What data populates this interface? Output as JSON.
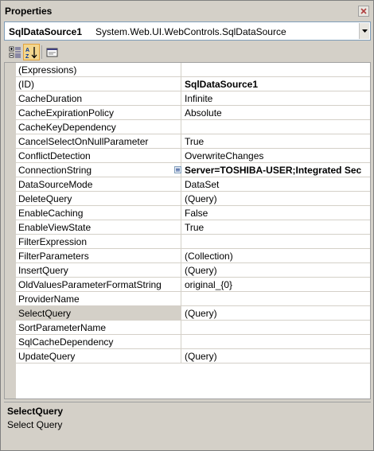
{
  "window": {
    "title": "Properties"
  },
  "selector": {
    "object_name": "SqlDataSource1",
    "object_type": "System.Web.UI.WebControls.SqlDataSource"
  },
  "toolbar": {
    "buttons": [
      {
        "icon": "categorized-icon",
        "active": false
      },
      {
        "icon": "alphabetical-sort-icon",
        "active": true
      },
      {
        "icon": "property-pages-icon",
        "active": false
      }
    ]
  },
  "properties": [
    {
      "name": "(Expressions)",
      "value": ""
    },
    {
      "name": "(ID)",
      "value": "SqlDataSource1",
      "bold": true
    },
    {
      "name": "CacheDuration",
      "value": "Infinite"
    },
    {
      "name": "CacheExpirationPolicy",
      "value": "Absolute"
    },
    {
      "name": "CacheKeyDependency",
      "value": ""
    },
    {
      "name": "CancelSelectOnNullParameter",
      "value": "True"
    },
    {
      "name": "ConflictDetection",
      "value": "OverwriteChanges"
    },
    {
      "name": "ConnectionString",
      "value": "Server=TOSHIBA-USER;Integrated Sec",
      "bold": true,
      "expandable": true
    },
    {
      "name": "DataSourceMode",
      "value": "DataSet"
    },
    {
      "name": "DeleteQuery",
      "value": "(Query)"
    },
    {
      "name": "EnableCaching",
      "value": "False"
    },
    {
      "name": "EnableViewState",
      "value": "True"
    },
    {
      "name": "FilterExpression",
      "value": ""
    },
    {
      "name": "FilterParameters",
      "value": "(Collection)"
    },
    {
      "name": "InsertQuery",
      "value": "(Query)"
    },
    {
      "name": "OldValuesParameterFormatString",
      "value": "original_{0}"
    },
    {
      "name": "ProviderName",
      "value": ""
    },
    {
      "name": "SelectQuery",
      "value": "(Query)",
      "selected": true
    },
    {
      "name": "SortParameterName",
      "value": ""
    },
    {
      "name": "SqlCacheDependency",
      "value": ""
    },
    {
      "name": "UpdateQuery",
      "value": "(Query)"
    }
  ],
  "description": {
    "title": "SelectQuery",
    "text": "Select Query"
  }
}
